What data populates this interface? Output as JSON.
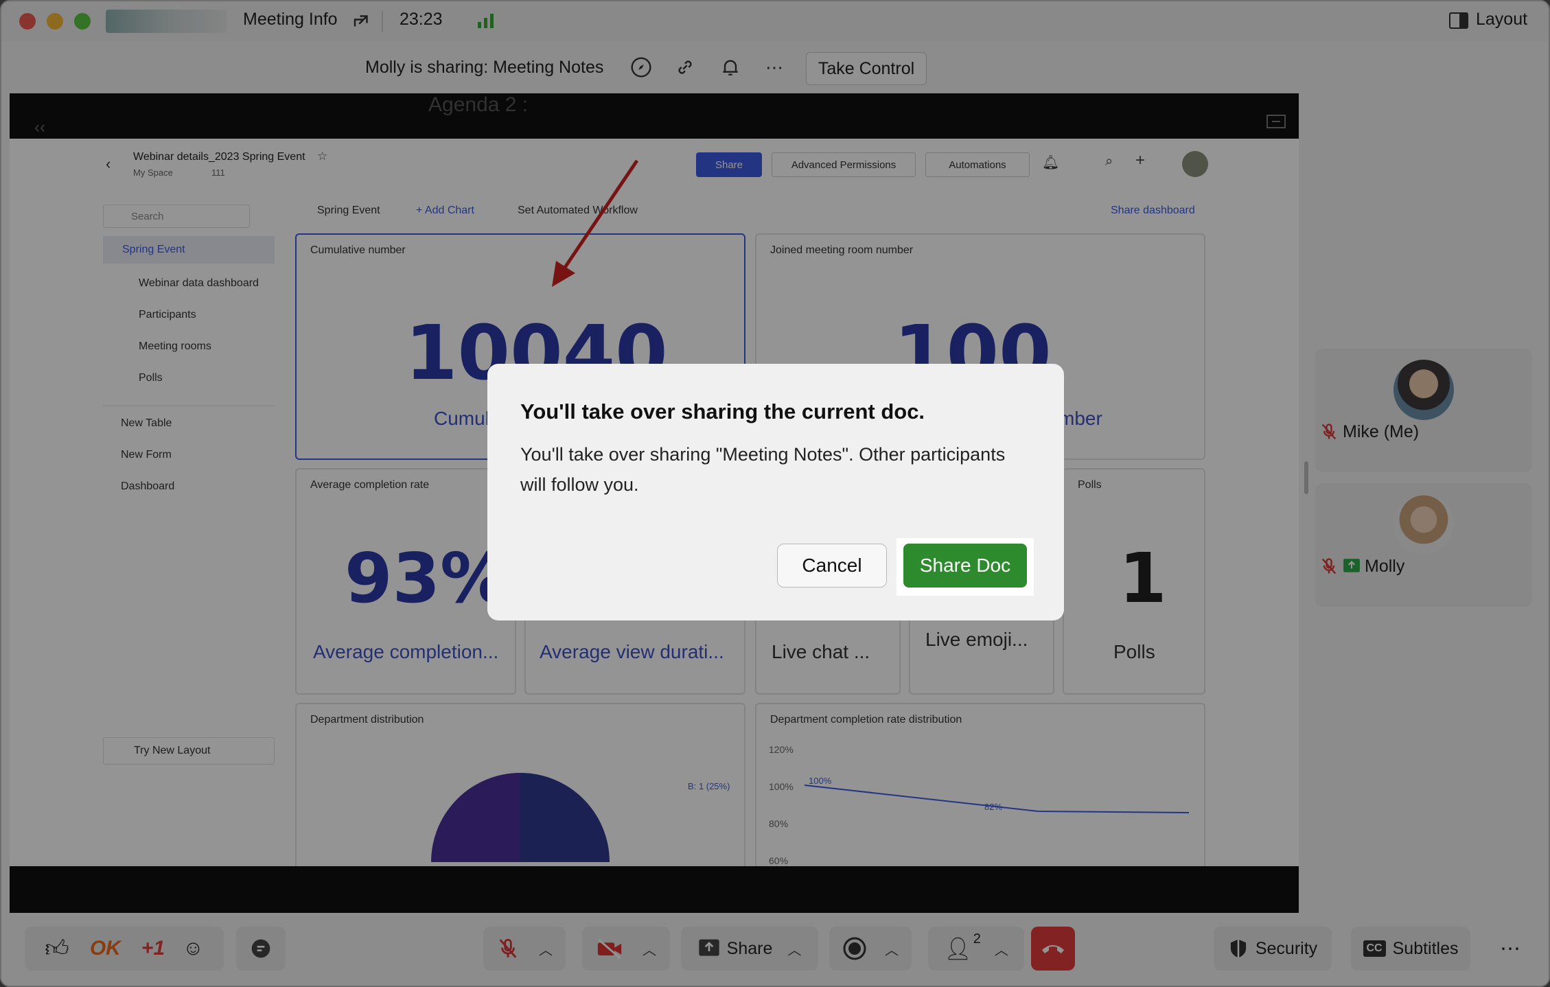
{
  "titlebar": {
    "title": "Meeting Info",
    "time": "23:23",
    "layout_label": "Layout"
  },
  "sharebar": {
    "sharing_text": "Molly is sharing: Meeting Notes",
    "take_control_label": "Take Control"
  },
  "shared_doc": {
    "agenda_text": "Agenda 2 :",
    "doc_title": "Webinar details_2023 Spring Event",
    "space": "My Space",
    "count": "111",
    "share_label": "Share",
    "adv_perm_label": "Advanced Permissions",
    "automations_label": "Automations",
    "search_placeholder": "Search",
    "sidebar": [
      {
        "label": "Spring Event",
        "active": true
      },
      {
        "label": "Webinar data dashboard"
      },
      {
        "label": "Participants"
      },
      {
        "label": "Meeting rooms"
      },
      {
        "label": "Polls"
      }
    ],
    "new_items": [
      {
        "label": "New Table"
      },
      {
        "label": "New Form"
      },
      {
        "label": "Dashboard"
      }
    ],
    "try_layout": "Try New Layout",
    "toolbar": {
      "dashboard_name": "Spring Event",
      "add_chart": "+ Add Chart",
      "set_workflow": "Set Automated Workflow",
      "share_dashboard": "Share dashboard"
    },
    "cards": {
      "cumulative": {
        "title": "Cumulative number",
        "value": "10040",
        "sub": "Cumul"
      },
      "joined": {
        "title": "Joined meeting room number",
        "value": "100",
        "sub": "mber"
      },
      "avg_completion": {
        "title": "Average completion rate",
        "value": "93%",
        "sub": "Average completion..."
      },
      "avg_view": {
        "sub": "Average view durati..."
      },
      "live_chat": {
        "sub": "Live chat ..."
      },
      "live_emoji": {
        "sub": "Live emoji..."
      },
      "polls": {
        "title": "Polls",
        "value": "1",
        "sub": "Polls"
      },
      "dept_dist": {
        "title": "Department distribution",
        "pie_label": "B: 1 (25%)"
      },
      "dept_rate": {
        "title": "Department completion rate distribution",
        "yticks": [
          "120%",
          "100%",
          "80%",
          "60%"
        ],
        "point_labels": [
          "100%",
          "82%"
        ]
      }
    }
  },
  "dialog": {
    "title": "You'll take over sharing the current doc.",
    "body": "You'll take over sharing \"Meeting Notes\". Other participants will follow you.",
    "cancel_label": "Cancel",
    "confirm_label": "Share Doc"
  },
  "participants": [
    {
      "name": "Mike (Me)"
    },
    {
      "name": "Molly"
    }
  ],
  "bottom": {
    "ok_label": "OK",
    "plus_one_label": "+1",
    "share_label": "Share",
    "participants_count": "2",
    "security_label": "Security",
    "subtitles_label": "Subtitles",
    "cc_label": "CC"
  },
  "colors": {
    "confirm_button": "#2d8a2d",
    "leave_button": "#e03b3b",
    "accent_blue": "#2b3aa8"
  }
}
